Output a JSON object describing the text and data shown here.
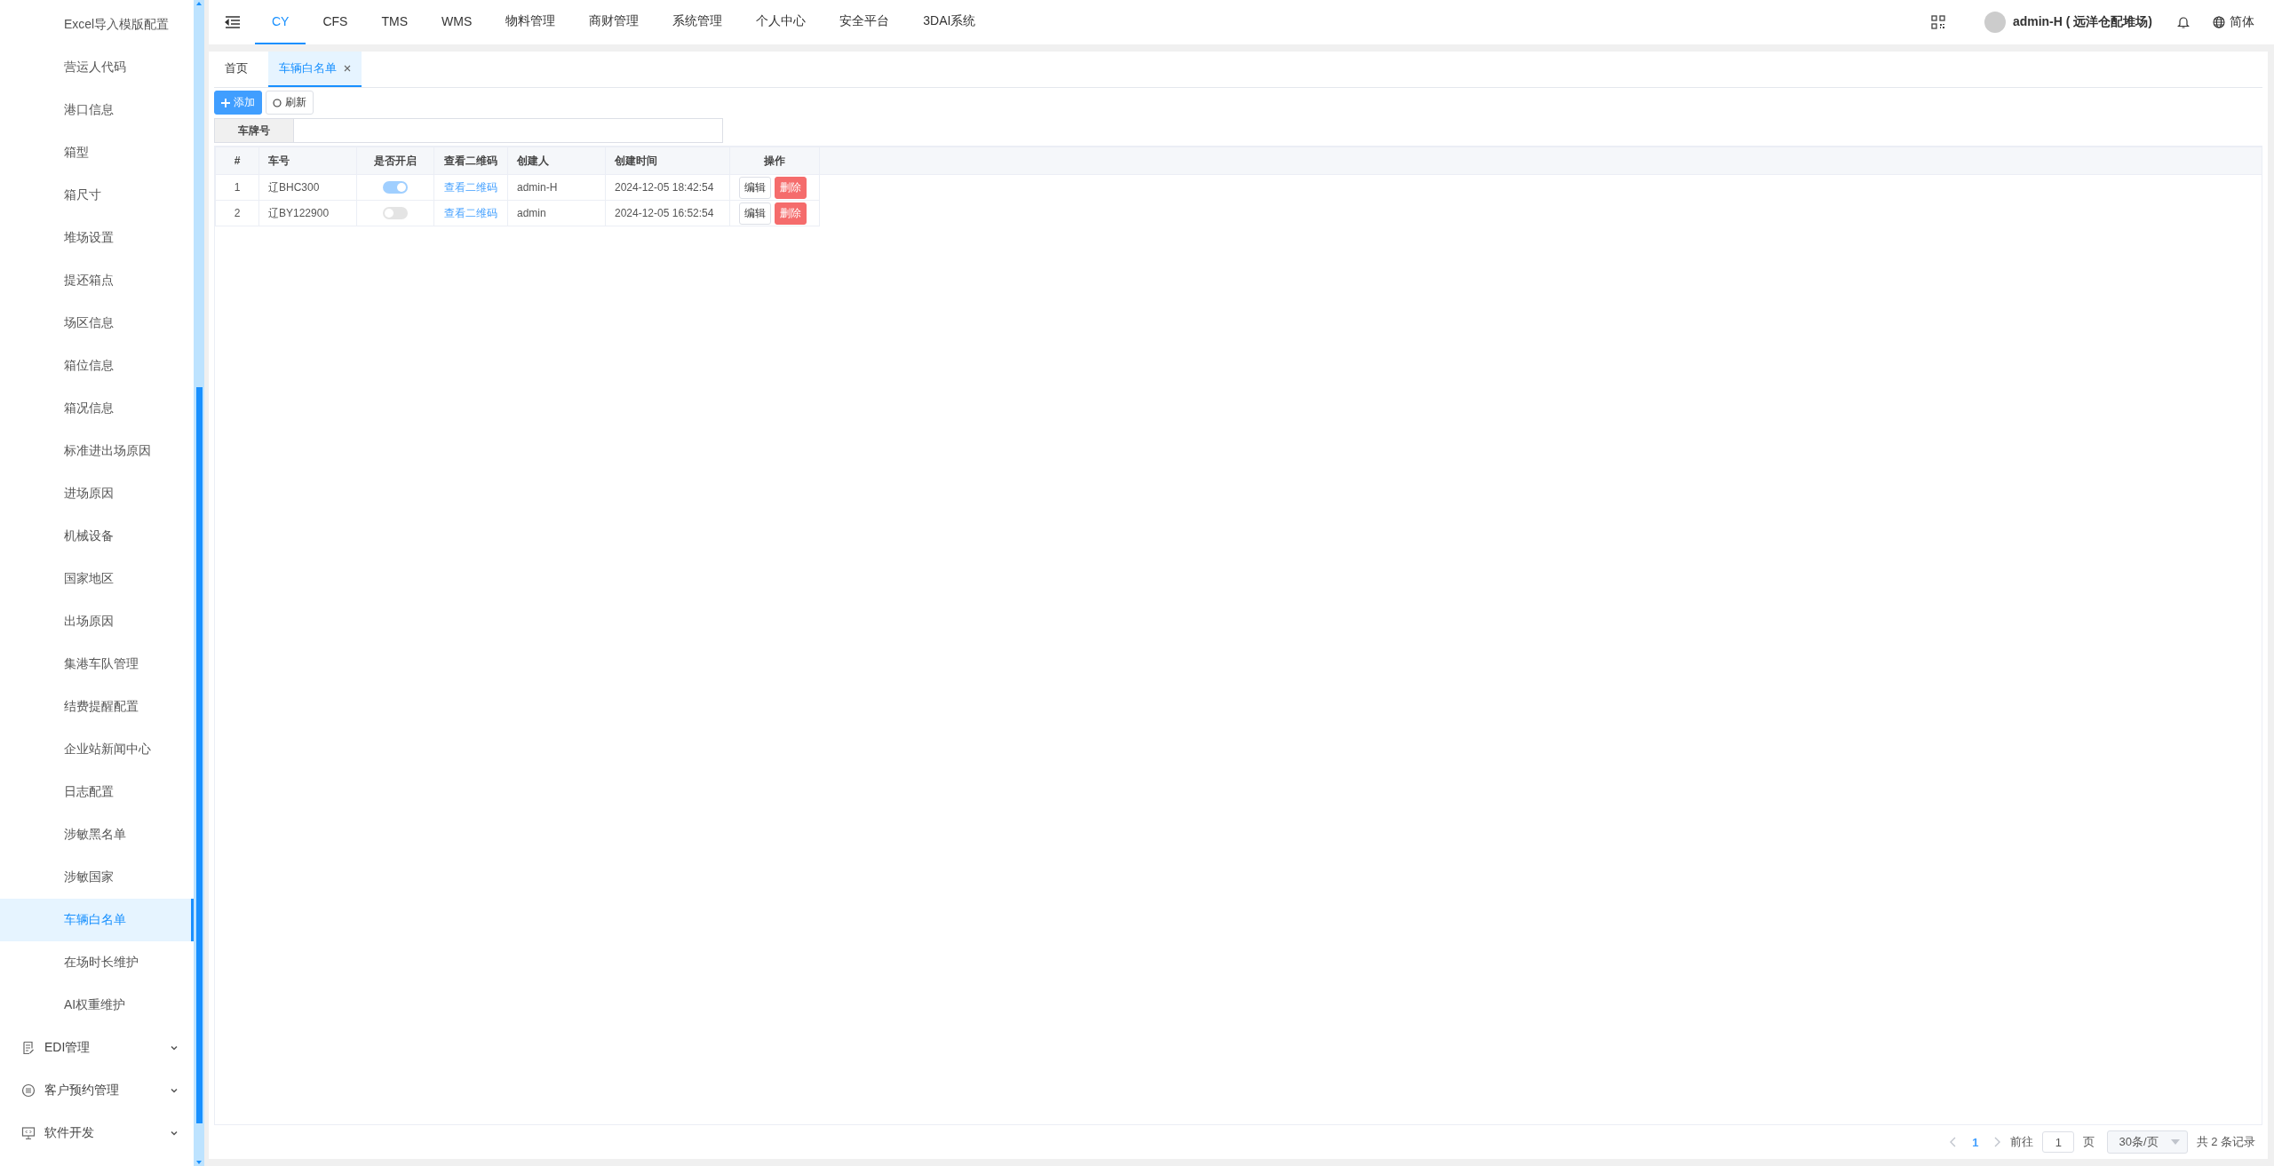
{
  "sidebar": {
    "items": [
      {
        "label": "Excel导入模版配置",
        "selected": false
      },
      {
        "label": "营运人代码",
        "selected": false
      },
      {
        "label": "港口信息",
        "selected": false
      },
      {
        "label": "箱型",
        "selected": false
      },
      {
        "label": "箱尺寸",
        "selected": false
      },
      {
        "label": "堆场设置",
        "selected": false
      },
      {
        "label": "提还箱点",
        "selected": false
      },
      {
        "label": "场区信息",
        "selected": false
      },
      {
        "label": "箱位信息",
        "selected": false
      },
      {
        "label": "箱况信息",
        "selected": false
      },
      {
        "label": "标准进出场原因",
        "selected": false
      },
      {
        "label": "进场原因",
        "selected": false
      },
      {
        "label": "机械设备",
        "selected": false
      },
      {
        "label": "国家地区",
        "selected": false
      },
      {
        "label": "出场原因",
        "selected": false
      },
      {
        "label": "集港车队管理",
        "selected": false
      },
      {
        "label": "结费提醒配置",
        "selected": false
      },
      {
        "label": "企业站新闻中心",
        "selected": false
      },
      {
        "label": "日志配置",
        "selected": false
      },
      {
        "label": "涉敏黑名单",
        "selected": false
      },
      {
        "label": "涉敏国家",
        "selected": false
      },
      {
        "label": "车辆白名单",
        "selected": true
      },
      {
        "label": "在场时长维护",
        "selected": false
      },
      {
        "label": "AI权重维护",
        "selected": false
      }
    ],
    "groups": [
      {
        "label": "EDI管理",
        "kind": "document",
        "expanded": false
      },
      {
        "label": "客户预约管理",
        "kind": "badge",
        "expanded": false
      },
      {
        "label": "软件开发",
        "kind": "monitor",
        "expanded": false
      }
    ]
  },
  "topnav": {
    "tabs": [
      {
        "label": "CY",
        "selected": true
      },
      {
        "label": "CFS",
        "selected": false
      },
      {
        "label": "TMS",
        "selected": false
      },
      {
        "label": "WMS",
        "selected": false
      },
      {
        "label": "物料管理",
        "selected": false
      },
      {
        "label": "商财管理",
        "selected": false
      },
      {
        "label": "系统管理",
        "selected": false
      },
      {
        "label": "个人中心",
        "selected": false
      },
      {
        "label": "安全平台",
        "selected": false
      },
      {
        "label": "3DAI系统",
        "selected": false
      }
    ],
    "user": "admin-H ( 远洋仓配堆场)",
    "language": "简体"
  },
  "page_tabs": [
    {
      "label": "首页",
      "selected": false,
      "closable": false
    },
    {
      "label": "车辆白名单",
      "selected": true,
      "closable": true
    }
  ],
  "toolbar": {
    "buttons": [
      {
        "label": "添加",
        "kind": "primary"
      },
      {
        "label": "刷新",
        "kind": "refresh"
      }
    ]
  },
  "search": {
    "label": "车牌号"
  },
  "table": {
    "columns": [
      "#",
      "车号",
      "是否开启",
      "查看二维码",
      "创建人",
      "创建时间",
      "操作"
    ],
    "rows": [
      {
        "index": "1",
        "plate": "辽BHC300",
        "enabled": true,
        "qr_link": "查看二维码",
        "creator": "admin-H",
        "created": "2024-12-05 18:42:54",
        "actions": [
          "编辑",
          "删除"
        ]
      },
      {
        "index": "2",
        "plate": "辽BY122900",
        "enabled": false,
        "qr_link": "查看二维码",
        "creator": "admin",
        "created": "2024-12-05 16:52:54",
        "actions": [
          "编辑",
          "删除"
        ]
      }
    ]
  },
  "pagination": {
    "pages": [
      {
        "label": "1",
        "selected": true
      }
    ],
    "goto_label": "前往",
    "goto_value": "1",
    "page_unit": "页",
    "page_size": "30条/页",
    "total": "共 2 条记录"
  }
}
